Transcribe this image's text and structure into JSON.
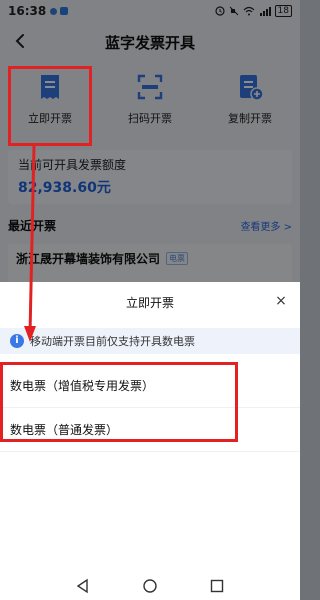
{
  "status": {
    "time": "16:38",
    "battery": "18"
  },
  "nav": {
    "title": "蓝字发票开具",
    "back_icon": "chevron-left-icon"
  },
  "quick_actions": [
    {
      "label": "立即开票",
      "icon": "invoice-icon"
    },
    {
      "label": "扫码开票",
      "icon": "scan-icon"
    },
    {
      "label": "复制开票",
      "icon": "copy-invoice-icon"
    }
  ],
  "quota": {
    "label": "当前可开具发票额度",
    "amount": "82,938.60元"
  },
  "recent": {
    "title": "最近开票",
    "more": "查看更多 >",
    "company": "浙江晟开幕墙装饰有限公司",
    "tag": "电票"
  },
  "sheet": {
    "title": "立即开票",
    "close": "×",
    "notice": "移动端开票目前仅支持开具数电票",
    "options": [
      {
        "label": "数电票（增值税专用发票）"
      },
      {
        "label": "数电票（普通发票）"
      }
    ]
  },
  "colors": {
    "accent": "#1f62d9",
    "annotation": "#e22222"
  }
}
